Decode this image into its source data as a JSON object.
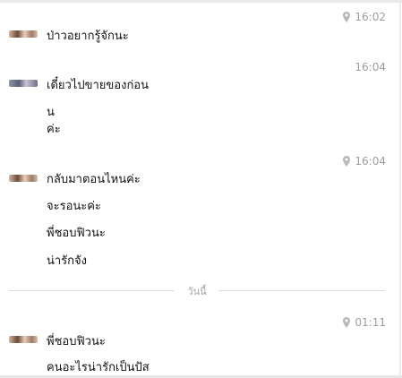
{
  "groups": [
    {
      "time": "16:02",
      "show_pin": true,
      "avatar": "avatar-a",
      "messages": [
        "ป่าวอยากรู้จักนะ"
      ]
    },
    {
      "time": "16:04",
      "show_pin": false,
      "avatar": "avatar-b",
      "messages": [
        "เดี๋ยวไปขายของก่อน",
        "น",
        "ค่ะ"
      ]
    },
    {
      "time": "16:04",
      "show_pin": true,
      "avatar": "avatar-a",
      "messages": [
        "กลับมาตอนไหนค่ะ",
        "จะรอนะค่ะ",
        "พี่ชอบฟิวนะ",
        "น่ารักจัง"
      ]
    },
    {
      "time": "01:11",
      "show_pin": true,
      "avatar": "avatar-a",
      "messages": [
        "พี่ชอบฟิวนะ",
        "คนอะไรน่ารักเป็นปัส"
      ]
    }
  ],
  "date_divider": {
    "label": "วันนี้"
  },
  "icons": {
    "pin": "location-pin-icon"
  },
  "colors": {
    "text": "#111111",
    "meta": "#9e9e9e",
    "divider": "#dcdcdc"
  }
}
